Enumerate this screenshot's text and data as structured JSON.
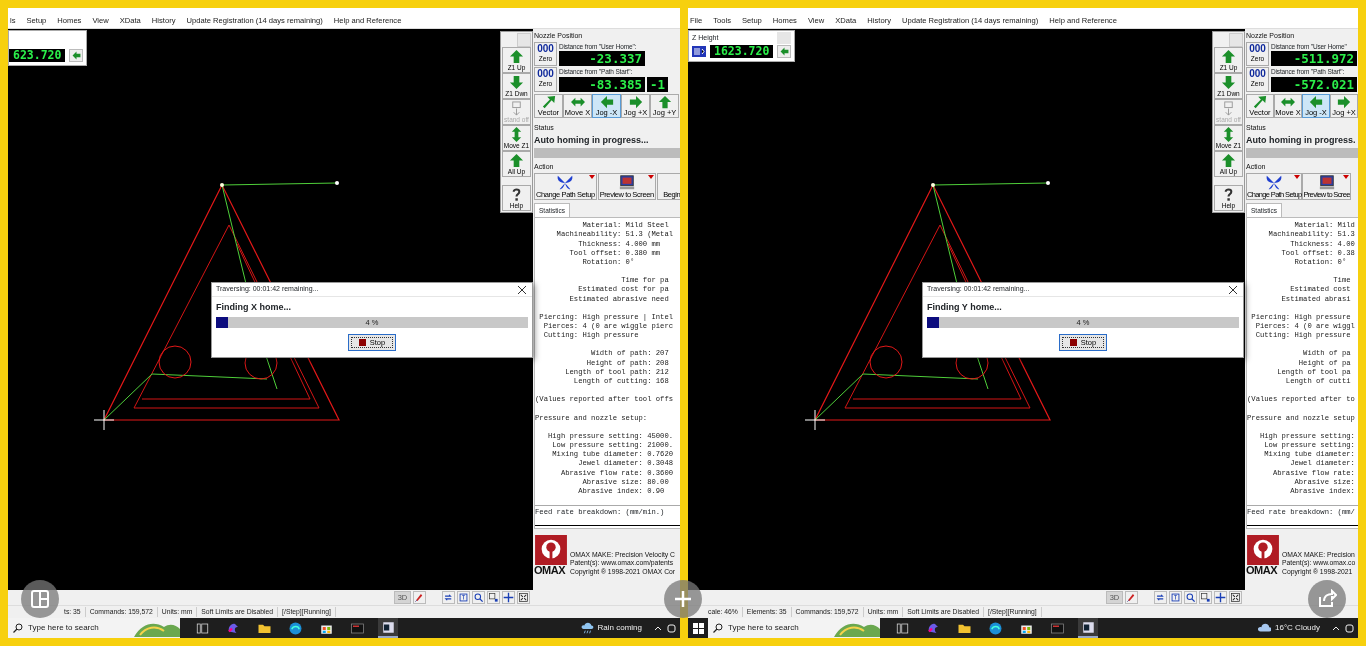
{
  "panels": [
    {
      "menu": [
        "ls",
        "Setup",
        "Homes",
        "View",
        "XData",
        "History",
        "Update Registration (14 days remaining)",
        "Help and Reference"
      ],
      "z_height": {
        "value": "623.720",
        "icon_shown": false
      },
      "tools": [
        {
          "label": "Z1 Up",
          "kind": "up",
          "disabled": false
        },
        {
          "label": "Z1 Dwn",
          "kind": "down",
          "disabled": false
        },
        {
          "label": "stand off",
          "kind": "standoff",
          "disabled": true
        },
        {
          "label": "Move Z1",
          "kind": "updown",
          "disabled": false
        },
        {
          "label": "All Up",
          "kind": "up",
          "disabled": false
        },
        {
          "label": "Help",
          "kind": "help",
          "disabled": false
        }
      ],
      "nozzle": {
        "heading": "Nozzle Position",
        "rows": [
          {
            "counter": "000",
            "zero": "Zero",
            "label": "Distance from \"User Home\":",
            "readouts": [
              "-23.337"
            ]
          },
          {
            "counter": "000",
            "zero": "Zero",
            "label": "Distance from \"Path Start\":",
            "readouts": [
              "-83.385",
              "-1"
            ]
          }
        ]
      },
      "jog": [
        {
          "label": "Vector",
          "kind": "diag",
          "selected": false
        },
        {
          "label": "Move X",
          "kind": "horiz",
          "selected": false
        },
        {
          "label": "Jog -X",
          "kind": "left",
          "selected": true
        },
        {
          "label": "Jog +X",
          "kind": "right",
          "selected": false
        },
        {
          "label": "Jog +Y",
          "kind": "up",
          "selected": false
        }
      ],
      "status": {
        "heading": "Status",
        "text": "Auto homing in progress..."
      },
      "action": {
        "heading": "Action",
        "buttons": [
          {
            "label": "Change Path Setup",
            "kind": "butterfly"
          },
          {
            "label": "Preview to Screen",
            "kind": "monitor"
          },
          {
            "label": "Begin",
            "kind": "partial"
          }
        ]
      },
      "statistics": {
        "tab": "Statistics",
        "selected": true,
        "blocks": [
          [
            "           Material: Mild Steel",
            "     Machineability: 51.3 (Metal",
            "          Thickness: 4.000 mm",
            "        Tool offset: 0.380 mm",
            "           Rotation: 0°"
          ],
          [
            "                    Time for pa",
            "          Estimated cost for pa",
            "        Estimated abrasive need"
          ],
          [
            " Piercing: High pressure | Intel",
            "  Pierces: 4 (0 are wiggle pierc",
            "  Cutting: High pressure"
          ],
          [
            "             Width of path: 207",
            "            Height of path: 208",
            "       Length of tool path: 212",
            "         Length of cutting: 168"
          ],
          [
            "(Values reported after tool offs"
          ],
          [
            "Pressure and nozzle setup:"
          ],
          [
            "   High pressure setting: 45000.",
            "    Low pressure setting: 21000.",
            "    Mixing tube diameter: 0.7620",
            "          Jewel diameter: 0.3048",
            "      Abrasive flow rate: 0.3600",
            "           Abrasive size: 80.00",
            "          Abrasive index: 0.90"
          ]
        ],
        "footer": "Feed rate breakdown: (mm/min.)"
      },
      "logo": {
        "wordmark": "OMAX",
        "lines": [
          "OMAX MAKE: Precision Velocity C",
          "Patent(s): www.omax.com/patents",
          "Copyright ® 1998-2021 OMAX Cor"
        ]
      },
      "dialog": {
        "title": "Traversing: 00:01:42  remaining...",
        "message": "Finding X home...",
        "level": 0.04,
        "percent": "4 %",
        "button": "Stop"
      },
      "view_tools": [
        {
          "kind": "label",
          "label": "3D",
          "disabled": true
        },
        {
          "kind": "pen",
          "disabled": false
        },
        {
          "kind": "redraw",
          "disabled": false
        },
        {
          "kind": "zoombox",
          "disabled": false
        },
        {
          "kind": "zoom",
          "disabled": false
        },
        {
          "kind": "zoomwindow",
          "disabled": false
        },
        {
          "kind": "pan",
          "disabled": false
        },
        {
          "kind": "fit",
          "disabled": false
        }
      ],
      "status_bar": [
        "ts: 35",
        "Commands: 159,572",
        "Units: mm",
        "Soft Limits are Disabled",
        "[/Step][Running]"
      ],
      "taskbar": {
        "start_shown": false,
        "search_placeholder": "Type here to search",
        "apps": [
          {
            "kind": "taskview",
            "active": false
          },
          {
            "kind": "copilot",
            "active": false
          },
          {
            "kind": "folder",
            "active": false
          },
          {
            "kind": "browser",
            "active": false
          },
          {
            "kind": "store",
            "active": false
          },
          {
            "kind": "console",
            "active": false
          },
          {
            "kind": "app",
            "active": true
          }
        ],
        "weather": {
          "kind": "rain",
          "text": "Rain coming"
        }
      }
    },
    {
      "menu": [
        "File",
        "Tools",
        "Setup",
        "Homes",
        "View",
        "XData",
        "History",
        "Update Registration (14 days remaining)",
        "Help and Reference"
      ],
      "z_height": {
        "title": "Z Height",
        "value": "1623.720",
        "icon_shown": true
      },
      "tools": [
        {
          "label": "Z1 Up",
          "kind": "up",
          "disabled": false
        },
        {
          "label": "Z1 Dwn",
          "kind": "down",
          "disabled": false
        },
        {
          "label": "stand off",
          "kind": "standoff",
          "disabled": true
        },
        {
          "label": "Move Z1",
          "kind": "updown",
          "disabled": false
        },
        {
          "label": "All Up",
          "kind": "up",
          "disabled": false
        },
        {
          "label": "Help",
          "kind": "help",
          "disabled": false
        }
      ],
      "nozzle": {
        "heading": "Nozzle Position",
        "rows": [
          {
            "counter": "000",
            "zero": "Zero",
            "label": "Distance from \"User Home\"",
            "readouts": [
              "-511.972"
            ]
          },
          {
            "counter": "000",
            "zero": "Zero",
            "label": "Distance from \"Path Start\":",
            "readouts": [
              "-572.021"
            ]
          }
        ]
      },
      "jog": [
        {
          "label": "Vector",
          "kind": "diag",
          "selected": false
        },
        {
          "label": "Move X",
          "kind": "horiz",
          "selected": false
        },
        {
          "label": "Jog -X",
          "kind": "left",
          "selected": true
        },
        {
          "label": "Jog +X",
          "kind": "right",
          "selected": false
        }
      ],
      "status": {
        "heading": "Status",
        "text": "Auto homing in progress."
      },
      "action": {
        "heading": "Action",
        "buttons": [
          {
            "label": "Change Path Setup",
            "kind": "butterfly"
          },
          {
            "label": "Preview to Scree",
            "kind": "monitor"
          }
        ]
      },
      "statistics": {
        "tab": "Statistics",
        "selected": true,
        "blocks": [
          [
            "           Material: Mild",
            "     Machineability: 51.3",
            "          Thickness: 4.00",
            "        Tool offset: 0.38",
            "           Rotation: 0°"
          ],
          [
            "                    Time",
            "          Estimated cost",
            "        Estimated abrasi"
          ],
          [
            " Piercing: High pressure",
            "  Pierces: 4 (0 are wiggl",
            "  Cutting: High pressure"
          ],
          [
            "             Width of pa",
            "            Height of pa",
            "       Length of tool pa",
            "         Length of cutti"
          ],
          [
            "(Values reported after to"
          ],
          [
            "Pressure and nozzle setup"
          ],
          [
            "   High pressure setting:",
            "    Low pressure setting:",
            "    Mixing tube diameter:",
            "          Jewel diameter:",
            "      Abrasive flow rate:",
            "           Abrasive size:",
            "          Abrasive index:"
          ]
        ],
        "footer": "Feed rate breakdown: (mm/"
      },
      "logo": {
        "wordmark": "OMAX",
        "lines": [
          "OMAX MAKE: Precision",
          "Patent(s): www.omax.co",
          "Copyright ® 1998-2021"
        ]
      },
      "dialog": {
        "title": "Traversing: 00:01:42  remaining...",
        "message": "Finding Y home...",
        "level": 0.04,
        "percent": "4 %",
        "button": "Stop"
      },
      "view_tools": [
        {
          "kind": "label",
          "label": "3D",
          "disabled": true
        },
        {
          "kind": "pen",
          "disabled": false
        },
        {
          "kind": "redraw",
          "disabled": false
        },
        {
          "kind": "zoombox",
          "disabled": false
        },
        {
          "kind": "zoom",
          "disabled": false
        },
        {
          "kind": "zoomwindow",
          "disabled": false
        },
        {
          "kind": "pan",
          "disabled": false
        },
        {
          "kind": "fit",
          "disabled": false
        }
      ],
      "status_bar": [
        "cale: 46%",
        "Elements: 35",
        "Commands: 159,572",
        "Units: mm",
        "Soft Limits are Disabled",
        "[/Step][Running]"
      ],
      "taskbar": {
        "start_shown": true,
        "search_placeholder": "Type here to search",
        "apps": [
          {
            "kind": "taskview",
            "active": false
          },
          {
            "kind": "copilot",
            "active": false
          },
          {
            "kind": "folder",
            "active": false
          },
          {
            "kind": "browser",
            "active": false
          },
          {
            "kind": "store",
            "active": false
          },
          {
            "kind": "console",
            "active": false
          },
          {
            "kind": "app",
            "active": true
          }
        ],
        "weather": {
          "kind": "cloud",
          "text": "16°C  Cloudy"
        }
      }
    }
  ],
  "overlay_buttons": [
    {
      "kind": "split"
    },
    {
      "kind": "plus"
    },
    {
      "kind": "share"
    }
  ]
}
